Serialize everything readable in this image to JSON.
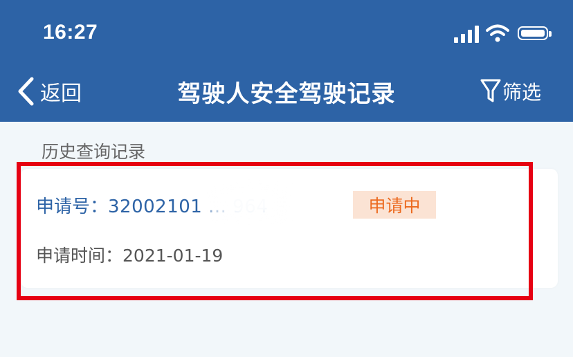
{
  "status_bar": {
    "time": "16:27",
    "icons": [
      "signal-icon",
      "wifi-icon",
      "battery-icon"
    ]
  },
  "nav": {
    "back_label": "返回",
    "title": "驾驶人安全驾驶记录",
    "filter_label": "筛选"
  },
  "section": {
    "title": "历史查询记录"
  },
  "record": {
    "number_label": "申请号：",
    "number_value": "32002101 ... 964",
    "status": "申请中",
    "date_label": "申请时间：",
    "date_value": "2021-01-19"
  },
  "colors": {
    "header_bg": "#2d63a6",
    "highlight": "#e60012",
    "badge_bg": "#fbe3d4",
    "badge_text": "#ec6a1f",
    "link_blue": "#2d63a6"
  }
}
